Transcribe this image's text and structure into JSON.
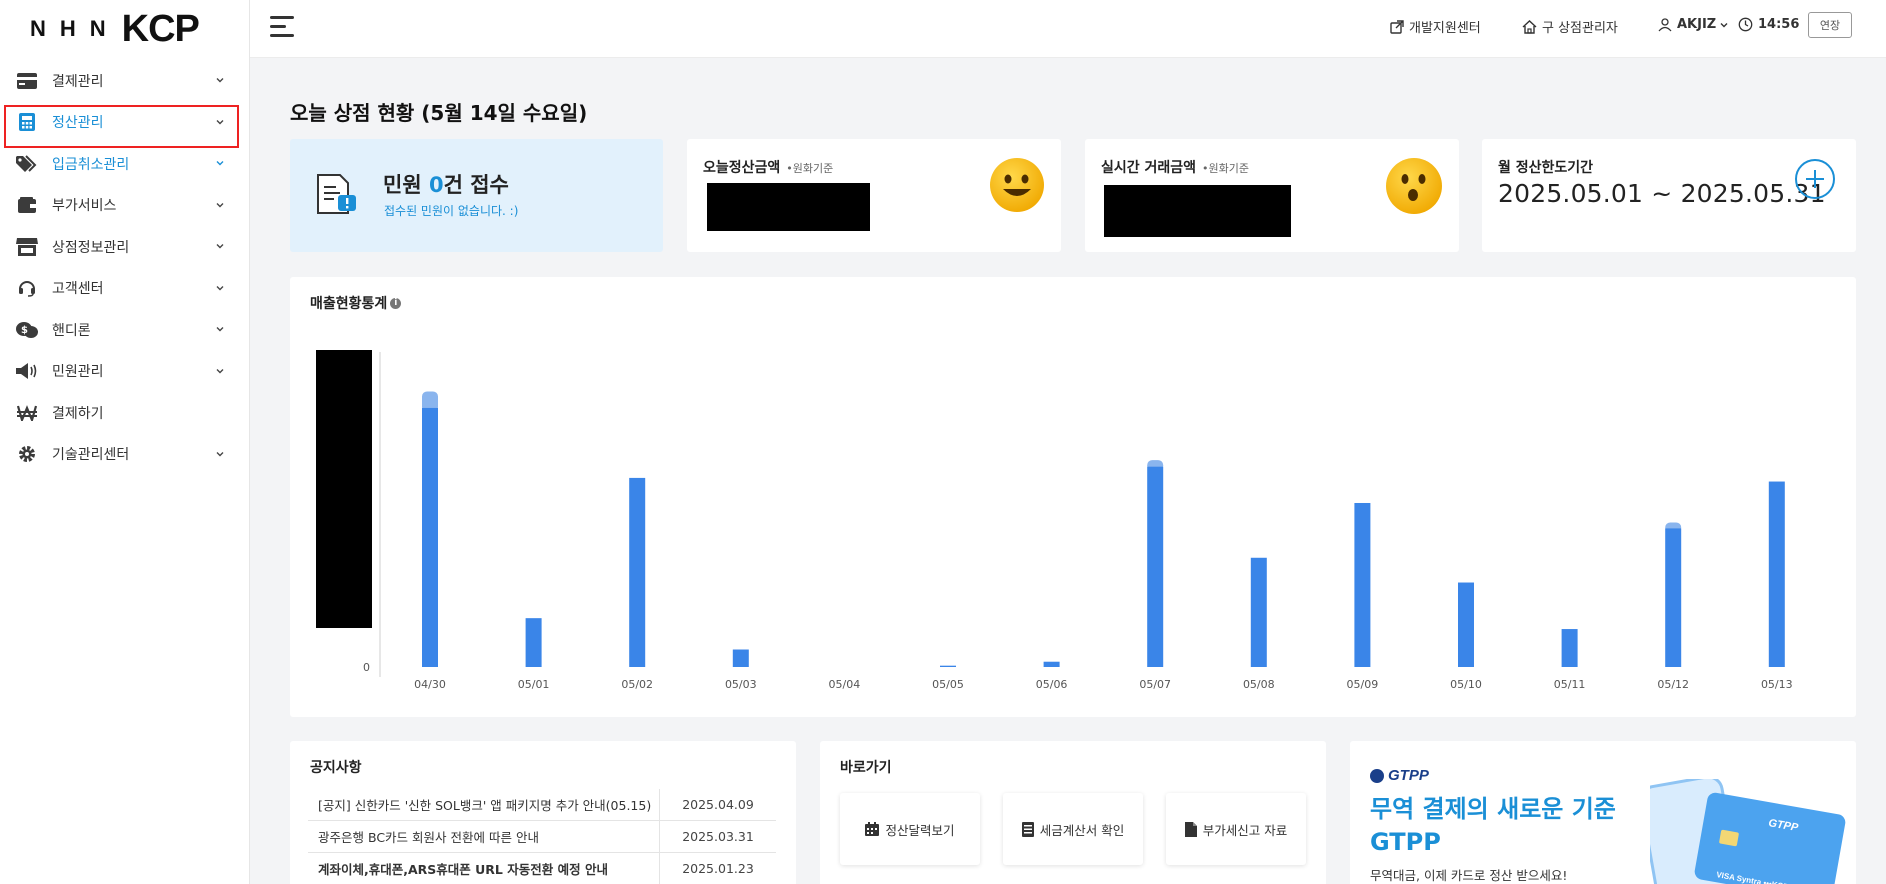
{
  "logo": {
    "nhn": "NHN",
    "kcp": "KCP"
  },
  "sidebar": {
    "items": [
      {
        "label": "결제관리",
        "icon": "card-icon",
        "has_chevron": true
      },
      {
        "label": "정산관리",
        "icon": "calculator-icon",
        "has_chevron": true
      },
      {
        "label": "입금취소관리",
        "icon": "tag-icon",
        "has_chevron": true
      },
      {
        "label": "부가서비스",
        "icon": "wallet-icon",
        "has_chevron": true
      },
      {
        "label": "상점정보관리",
        "icon": "store-icon",
        "has_chevron": true
      },
      {
        "label": "고객센터",
        "icon": "headset-icon",
        "has_chevron": true
      },
      {
        "label": "핸디론",
        "icon": "money-chat-icon",
        "has_chevron": true
      },
      {
        "label": "민원관리",
        "icon": "megaphone-icon",
        "has_chevron": true
      },
      {
        "label": "결제하기",
        "icon": "won-icon",
        "has_chevron": false
      },
      {
        "label": "기술관리센터",
        "icon": "gear-icon",
        "has_chevron": true
      }
    ]
  },
  "header": {
    "dev_center": "개발지원센터",
    "old_admin": "구 상점관리자",
    "user": "AKJIZ",
    "time": "14:56",
    "extend_label": "연장"
  },
  "main": {
    "title": "오늘 상점 현황 (5월 14일 수요일)",
    "complaint": {
      "prefix": "민원 ",
      "count": "0",
      "suffix": "건 접수",
      "sub": "접수된 민원이 없습니다. :)"
    },
    "today_settlement": {
      "title": "오늘정산금액",
      "note": "•원화기준"
    },
    "realtime_tx": {
      "title": "실시간 거래금액",
      "note": "•원화기준"
    },
    "monthly_period": {
      "title": "월 정산한도기간",
      "value": "2025.05.01 ~ 2025.05.31"
    }
  },
  "chart_data": {
    "type": "bar",
    "title": "매출현황통계",
    "categories": [
      "04/30",
      "05/01",
      "05/02",
      "05/03",
      "05/04",
      "05/05",
      "05/06",
      "05/07",
      "05/08",
      "05/09",
      "05/10",
      "05/11",
      "05/12",
      "05/13"
    ],
    "series": [
      {
        "name": "",
        "values": [
          0.785,
          0.148,
          0.573,
          0.053,
          0,
          0.004,
          0.016,
          0.607,
          0.331,
          0.497,
          0.256,
          0.115,
          0.42,
          0.562
        ],
        "color": "#3a85e8"
      },
      {
        "name": "",
        "values": [
          0.05,
          0,
          0,
          0,
          0,
          0,
          0,
          0.02,
          0,
          0,
          0,
          0,
          0.018,
          0
        ],
        "color": "#8ab5ee"
      }
    ],
    "yticks": [
      "0"
    ],
    "y_top_label_redacted": true,
    "grid": false
  },
  "notices": {
    "title": "공지사항",
    "items": [
      {
        "title": "[공지] 신한카드 '신한 SOL뱅크' 앱 패키지명 추가 안내(05.15)",
        "date": "2025.04.09",
        "bold": false
      },
      {
        "title": "광주은행 BC카드 회원사 전환에 따른 안내",
        "date": "2025.03.31",
        "bold": false
      },
      {
        "title": "계좌이체,휴대폰,ARS휴대폰 URL 자동전환 예정 안내",
        "date": "2025.01.23",
        "bold": true
      }
    ]
  },
  "quick": {
    "title": "바로가기",
    "items": [
      {
        "label": "정산달력보기",
        "icon": "calendar-icon"
      },
      {
        "label": "세금계산서 확인",
        "icon": "receipt-icon"
      },
      {
        "label": "부가세신고 자료",
        "icon": "document-icon"
      }
    ]
  },
  "banner": {
    "logo": "GTPP",
    "headline": "무역 결제의 새로운 기준 GTPP",
    "sub": "무역대금, 이제 카드로 정산 받으세요!",
    "card_logo": "GTPP",
    "card_brands": "VISA  Syntra  •••KCP"
  },
  "colors": {
    "accent": "#1a8fd6",
    "bar": "#3a85e8",
    "bar_light": "#8ab5ee",
    "highlight": "#e22222"
  }
}
